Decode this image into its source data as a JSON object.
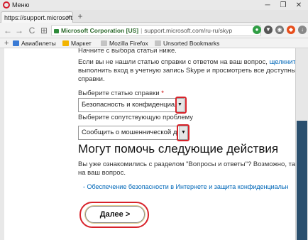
{
  "window": {
    "menu_label": "Меню",
    "controls": {
      "minimize": "─",
      "restore": "❐",
      "close": "✕"
    }
  },
  "tab": {
    "title": "https://support.microsoft.",
    "close": "×",
    "new_tab": "+"
  },
  "address": {
    "back": "←",
    "forward": "→",
    "reload": "C",
    "home": "⊞",
    "org": "Microsoft Corporation [US]",
    "url": "support.microsoft.com/ru-ru/skyp",
    "badge": "3"
  },
  "bookmarks": [
    {
      "label": "Авиабилеты",
      "color": "#3a7bd5"
    },
    {
      "label": "Маркет",
      "color": "#f2b400"
    },
    {
      "label": "Mozilla Firefox",
      "color": "#bbbbbb"
    },
    {
      "label": "Unsorted Bookmarks",
      "color": "#bbbbbb"
    }
  ],
  "page": {
    "intro_top": "Начните с выбора статьи ниже.",
    "para_line1": "Если вы не нашли статью справки с ответом на ваш вопрос,",
    "para_link": "щелкните зде",
    "para_line2": "выполнить вход в учетную запись Skype и просмотреть все доступные ста",
    "para_line3": "справки.",
    "label_article": "Выберите статью справки",
    "required_mark": "*",
    "select_article": "Безопасность и конфиденциал",
    "label_problem": "Выберите сопутствующую проблему",
    "select_problem": "Сообщить о мошеннической д",
    "heading": "Могут помочь следующие действия",
    "faq_line1": "Вы уже ознакомились с разделом \"Вопросы и ответы\"? Возможно, там уж",
    "faq_line2": "на ваш вопрос.",
    "suggest_link": "- Обеспечение безопасности в Интернете и защита конфиденциальн",
    "next_button": "Далее >"
  },
  "colors": {
    "accent_link": "#0067b8",
    "highlight_red": "#d8232a",
    "scroll_thumb": "#2a4f6e"
  }
}
